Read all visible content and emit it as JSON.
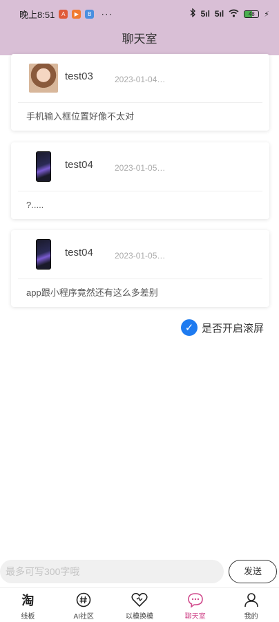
{
  "status_bar": {
    "time": "晚上8:51",
    "more": "···",
    "signal1": "5ıl",
    "signal2": "5ıl",
    "battery": "48",
    "apps": [
      {
        "icon": "app-icon-a",
        "color": "#e05a3a",
        "glyph": "A"
      },
      {
        "icon": "app-icon-video",
        "color": "#f07a30",
        "glyph": "▶"
      },
      {
        "icon": "app-icon-b",
        "color": "#4a8fe0",
        "glyph": "B"
      }
    ]
  },
  "header": {
    "title": "聊天室",
    "bg_color": "#d9bfd6"
  },
  "messages": [
    {
      "user": "test03",
      "time": "2023-01-04 ...",
      "text": "手机输入框位置好像不太对",
      "avatar": "girl-avatar"
    },
    {
      "user": "test04",
      "time": "2023-01-05 ...",
      "text": "?.....",
      "avatar": "phone-avatar"
    },
    {
      "user": "test04",
      "time": "2023-01-05 ...",
      "text": "app跟小程序竟然还有这么多差别",
      "avatar": "phone-avatar"
    }
  ],
  "autoscroll": {
    "label": "是否开启滚屏",
    "checked": true,
    "color": "#1e7bf0"
  },
  "input": {
    "placeholder": "最多可写300字哦",
    "value": ""
  },
  "send_label": "发送",
  "tabs": [
    {
      "label": "线板",
      "icon": "tao-icon",
      "glyph": "淘",
      "active": false
    },
    {
      "label": "AI社区",
      "icon": "hash-icon",
      "active": false
    },
    {
      "label": "以模换模",
      "icon": "heart-icon",
      "active": false
    },
    {
      "label": "聊天室",
      "icon": "chat-icon",
      "active": true
    },
    {
      "label": "我的",
      "icon": "user-icon",
      "active": false
    }
  ],
  "accent_color": "#d04a8c"
}
